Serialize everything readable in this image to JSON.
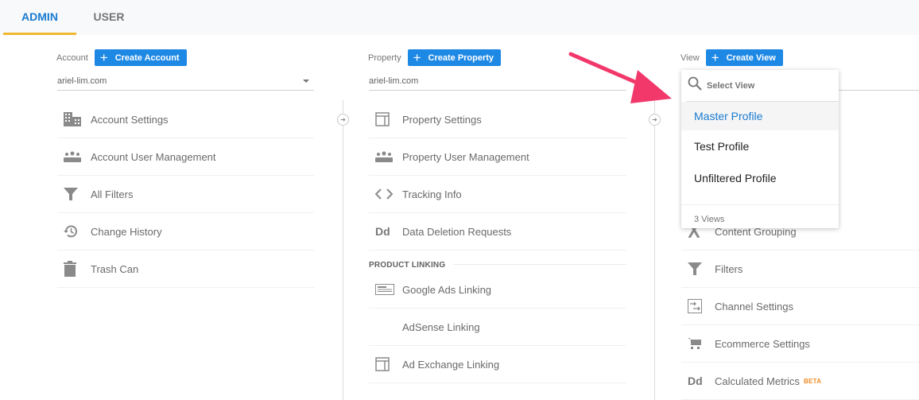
{
  "tabs": [
    {
      "label": "ADMIN",
      "active": true
    },
    {
      "label": "USER",
      "active": false
    }
  ],
  "colors": {
    "accent": "#1e88e5",
    "active_tab_text": "#1a7bd1",
    "active_tab_underline": "#f0b732",
    "annotation_arrow": "#f2386b",
    "beta_badge": "#f08a24"
  },
  "account": {
    "label": "Account",
    "create_label": "Create Account",
    "selected": "ariel-lim.com",
    "items": [
      {
        "label": "Account Settings",
        "icon": "building-icon"
      },
      {
        "label": "Account User Management",
        "icon": "people-icon"
      },
      {
        "label": "All Filters",
        "icon": "filter-icon"
      },
      {
        "label": "Change History",
        "icon": "history-icon"
      },
      {
        "label": "Trash Can",
        "icon": "trash-icon"
      }
    ]
  },
  "property": {
    "label": "Property",
    "create_label": "Create Property",
    "selected": "ariel-lim.com",
    "items": [
      {
        "label": "Property Settings",
        "icon": "window-icon"
      },
      {
        "label": "Property User Management",
        "icon": "people-icon"
      },
      {
        "label": "Tracking Info",
        "icon": "code-icon"
      },
      {
        "label": "Data Deletion Requests",
        "icon": "dd-icon"
      }
    ],
    "section_title": "PRODUCT LINKING",
    "linking_items": [
      {
        "label": "Google Ads Linking",
        "icon": "ads-icon"
      },
      {
        "label": "AdSense Linking",
        "icon": ""
      },
      {
        "label": "Ad Exchange Linking",
        "icon": "window-icon"
      }
    ]
  },
  "view": {
    "label": "View",
    "create_label": "Create View",
    "items": [
      {
        "label": "Content Grouping",
        "icon": "grouping-icon"
      },
      {
        "label": "Filters",
        "icon": "filter-icon"
      },
      {
        "label": "Channel Settings",
        "icon": "channel-icon"
      },
      {
        "label": "Ecommerce Settings",
        "icon": "cart-icon"
      },
      {
        "label": "Calculated Metrics",
        "icon": "dd-icon",
        "badge": "BETA"
      }
    ],
    "dropdown": {
      "search_placeholder": "Select View",
      "options": [
        {
          "label": "Master Profile",
          "selected": true
        },
        {
          "label": "Test Profile",
          "selected": false
        },
        {
          "label": "Unfiltered Profile",
          "selected": false
        }
      ],
      "footer": "3 Views"
    }
  }
}
